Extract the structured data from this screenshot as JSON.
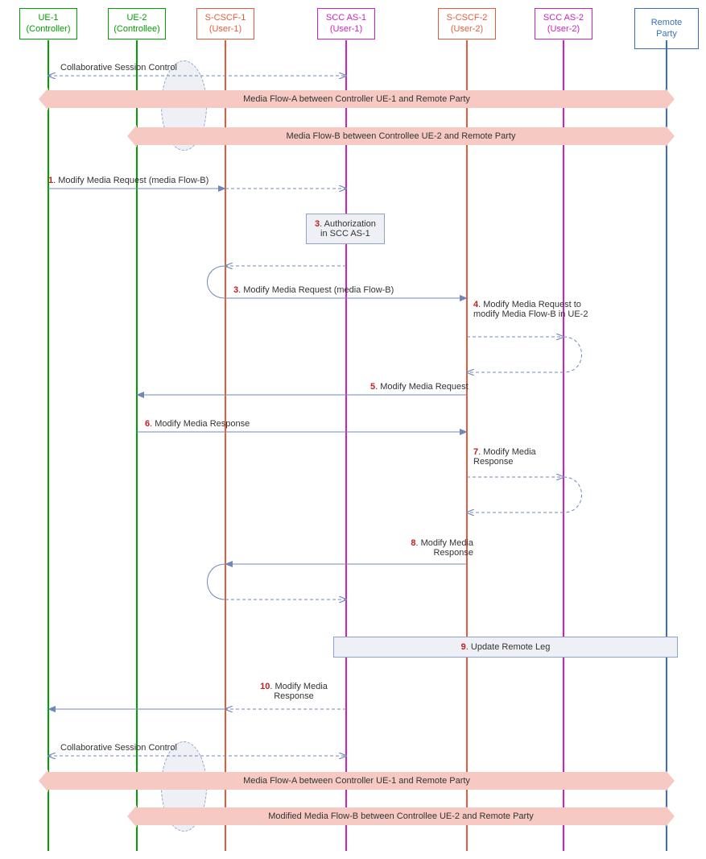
{
  "actors": {
    "ue1": {
      "title": "UE-1",
      "subtitle": "(Controller)"
    },
    "ue2": {
      "title": "UE-2",
      "subtitle": "(Controllee)"
    },
    "scscf1": {
      "title": "S-CSCF-1",
      "subtitle": "(User-1)"
    },
    "sccas1": {
      "title": "SCC AS-1",
      "subtitle": "(User-1)"
    },
    "scscf2": {
      "title": "S-CSCF-2",
      "subtitle": "(User-2)"
    },
    "sccas2": {
      "title": "SCC AS-2",
      "subtitle": "(User-2)"
    },
    "remote": {
      "title": "Remote Party"
    }
  },
  "flows": {
    "csc_top": "Collaborative Session Control",
    "media_a": "Media Flow-A between Controller UE-1 and Remote Party",
    "media_b": "Media Flow-B between Controllee UE-2 and Remote Party",
    "csc_bottom": "Collaborative Session Control",
    "media_a2": "Media Flow-A between Controller UE-1 and Remote Party",
    "media_b2": "Modified Media Flow-B between Controllee UE-2 and Remote Party"
  },
  "steps": {
    "s1": {
      "num": "1",
      "text": ". Modify Media Request (media Flow-B)"
    },
    "s2": {
      "num": "3",
      "text": ". Authorization in SCC AS-1"
    },
    "s3": {
      "num": "3",
      "text": ". Modify Media Request (media Flow-B)"
    },
    "s4": {
      "num": "4",
      "text": ". Modify Media Request to modify Media Flow-B in UE-2"
    },
    "s5": {
      "num": "5",
      "text": ". Modify Media Request"
    },
    "s6": {
      "num": "6",
      "text": ". Modify Media Response"
    },
    "s7": {
      "num": "7",
      "text": ". Modify Media Response"
    },
    "s8": {
      "num": "8",
      "text": ". Modify Media Response"
    },
    "s9": {
      "num": "9",
      "text": ". Update Remote Leg"
    },
    "s10": {
      "num": "10",
      "text": ". Modify Media Response"
    }
  }
}
